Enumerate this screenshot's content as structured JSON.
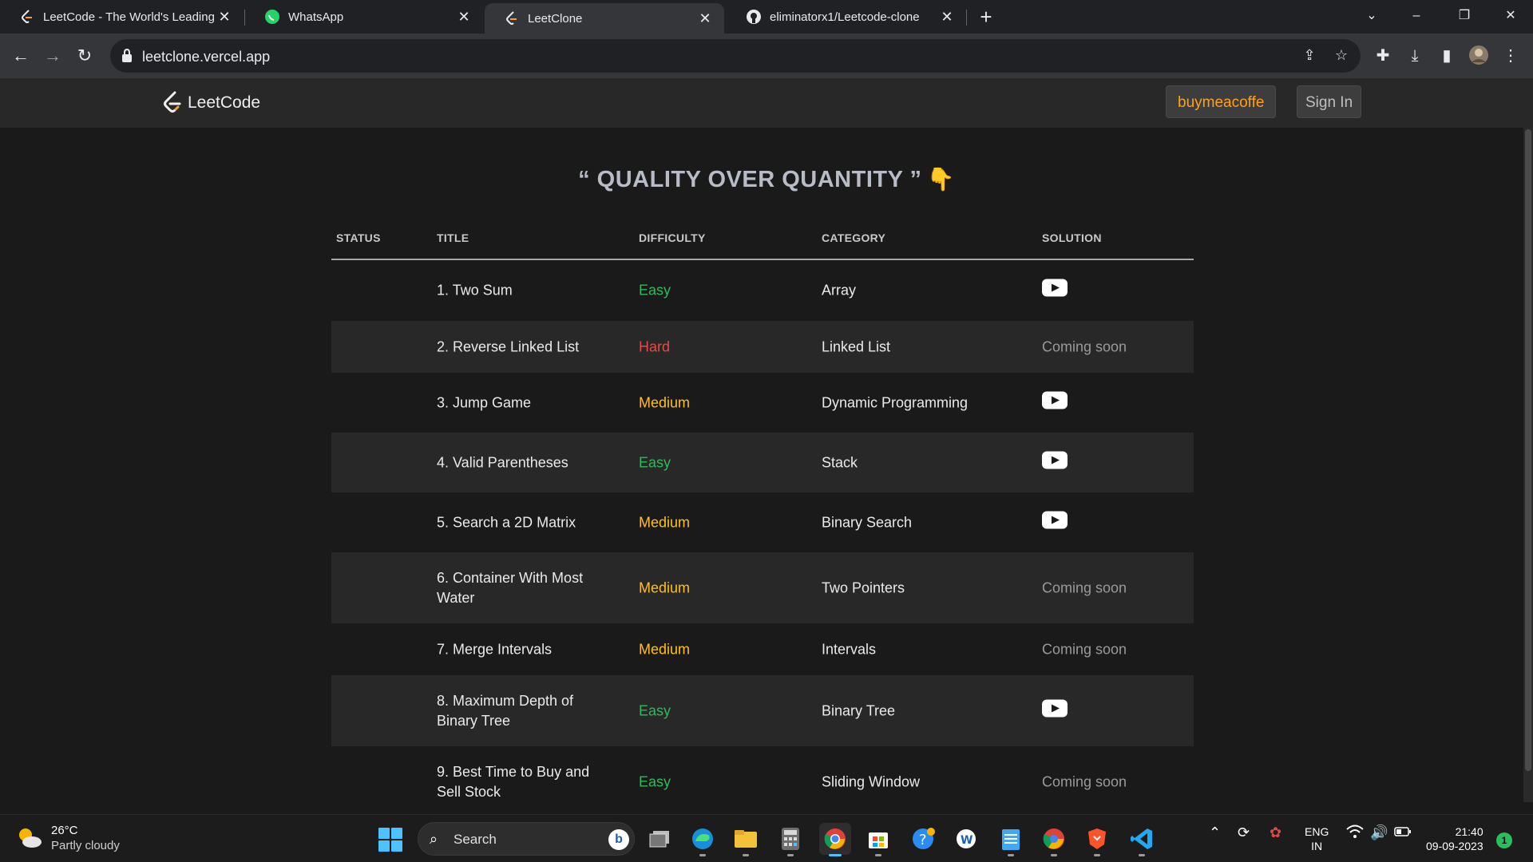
{
  "browser": {
    "tabs": [
      {
        "title": "LeetCode - The World's Leading",
        "favicon": "leetcode-icon"
      },
      {
        "title": "WhatsApp",
        "favicon": "whatsapp-icon"
      },
      {
        "title": "LeetClone",
        "favicon": "leetcode-icon"
      },
      {
        "title": "eliminatorx1/Leetcode-clone",
        "favicon": "github-icon"
      }
    ],
    "close_glyph": "✕",
    "new_tab_glyph": "+",
    "url": "leetclone.vercel.app"
  },
  "site": {
    "brand": "LeetCode",
    "coffee_label": "buymeacoffe",
    "signin_label": "Sign In",
    "headline": "“ QUALITY OVER QUANTITY ”",
    "headline_emoji": "👇"
  },
  "table": {
    "headers": [
      "STATUS",
      "TITLE",
      "DIFFICULTY",
      "CATEGORY",
      "SOLUTION"
    ],
    "rows": [
      {
        "title": "1. Two Sum",
        "difficulty": "Easy",
        "category": "Array",
        "solution": "youtube-icon"
      },
      {
        "title": "2. Reverse Linked List",
        "difficulty": "Hard",
        "category": "Linked List",
        "solution": "Coming soon"
      },
      {
        "title": "3. Jump Game",
        "difficulty": "Medium",
        "category": "Dynamic Programming",
        "solution": "youtube-icon"
      },
      {
        "title": "4. Valid Parentheses",
        "difficulty": "Easy",
        "category": "Stack",
        "solution": "youtube-icon"
      },
      {
        "title": "5. Search a 2D Matrix",
        "difficulty": "Medium",
        "category": "Binary Search",
        "solution": "youtube-icon"
      },
      {
        "title": "6. Container With Most Water",
        "difficulty": "Medium",
        "category": "Two Pointers",
        "solution": "Coming soon"
      },
      {
        "title": "7. Merge Intervals",
        "difficulty": "Medium",
        "category": "Intervals",
        "solution": "Coming soon"
      },
      {
        "title": "8. Maximum Depth of Binary Tree",
        "difficulty": "Easy",
        "category": "Binary Tree",
        "solution": "youtube-icon"
      },
      {
        "title": "9. Best Time to Buy and Sell Stock",
        "difficulty": "Easy",
        "category": "Sliding Window",
        "solution": "Coming soon"
      }
    ]
  },
  "colors": {
    "easy": "#2cbb5d",
    "medium": "#ffc01e",
    "hard": "#ef4743",
    "brand_orange": "#ffa116"
  },
  "taskbar": {
    "weather_temp": "26°C",
    "weather_desc": "Partly cloudy",
    "search_label": "Search",
    "lang_line1": "ENG",
    "lang_line2": "IN",
    "time": "21:40",
    "date": "09-09-2023",
    "notification_count": "1"
  }
}
